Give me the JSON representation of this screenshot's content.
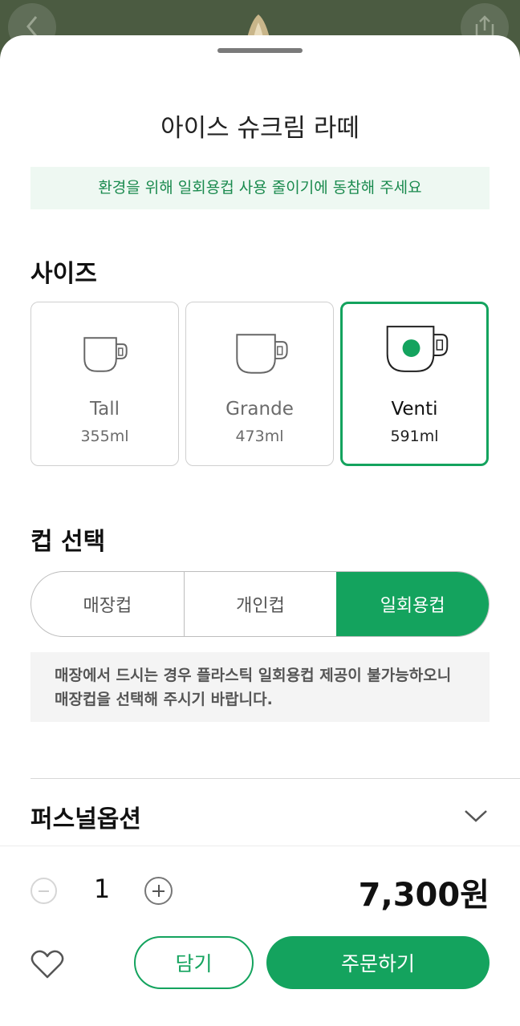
{
  "product": {
    "title": "아이스 슈크림 라떼",
    "notice": "환경을 위해 일회용컵 사용 줄이기에 동참해 주세요"
  },
  "size_section": {
    "title": "사이즈",
    "options": [
      {
        "name": "Tall",
        "volume": "355ml"
      },
      {
        "name": "Grande",
        "volume": "473ml"
      },
      {
        "name": "Venti",
        "volume": "591ml"
      }
    ],
    "selected": "Venti"
  },
  "cup_section": {
    "title": "컵 선택",
    "options": [
      "매장컵",
      "개인컵",
      "일회용컵"
    ],
    "selected": "일회용컵",
    "note": "매장에서 드시는 경우 플라스틱 일회용컵 제공이 불가능하오니 매장컵을 선택해 주시기 바랍니다."
  },
  "personal_option": {
    "label": "퍼스널옵션"
  },
  "footer": {
    "quantity": "1",
    "price": "7,300원",
    "cart_label": "담기",
    "order_label": "주문하기"
  },
  "icons": {
    "back": "chevron-left-icon",
    "share": "share-icon",
    "cup": "cup-icon",
    "chevron": "chevron-down-icon",
    "minus": "minus-circle-icon",
    "plus": "plus-circle-icon",
    "heart": "heart-icon"
  },
  "colors": {
    "accent": "#14a35e",
    "notice_bg": "#eef8f2",
    "note_bg": "#f4f4f4"
  }
}
